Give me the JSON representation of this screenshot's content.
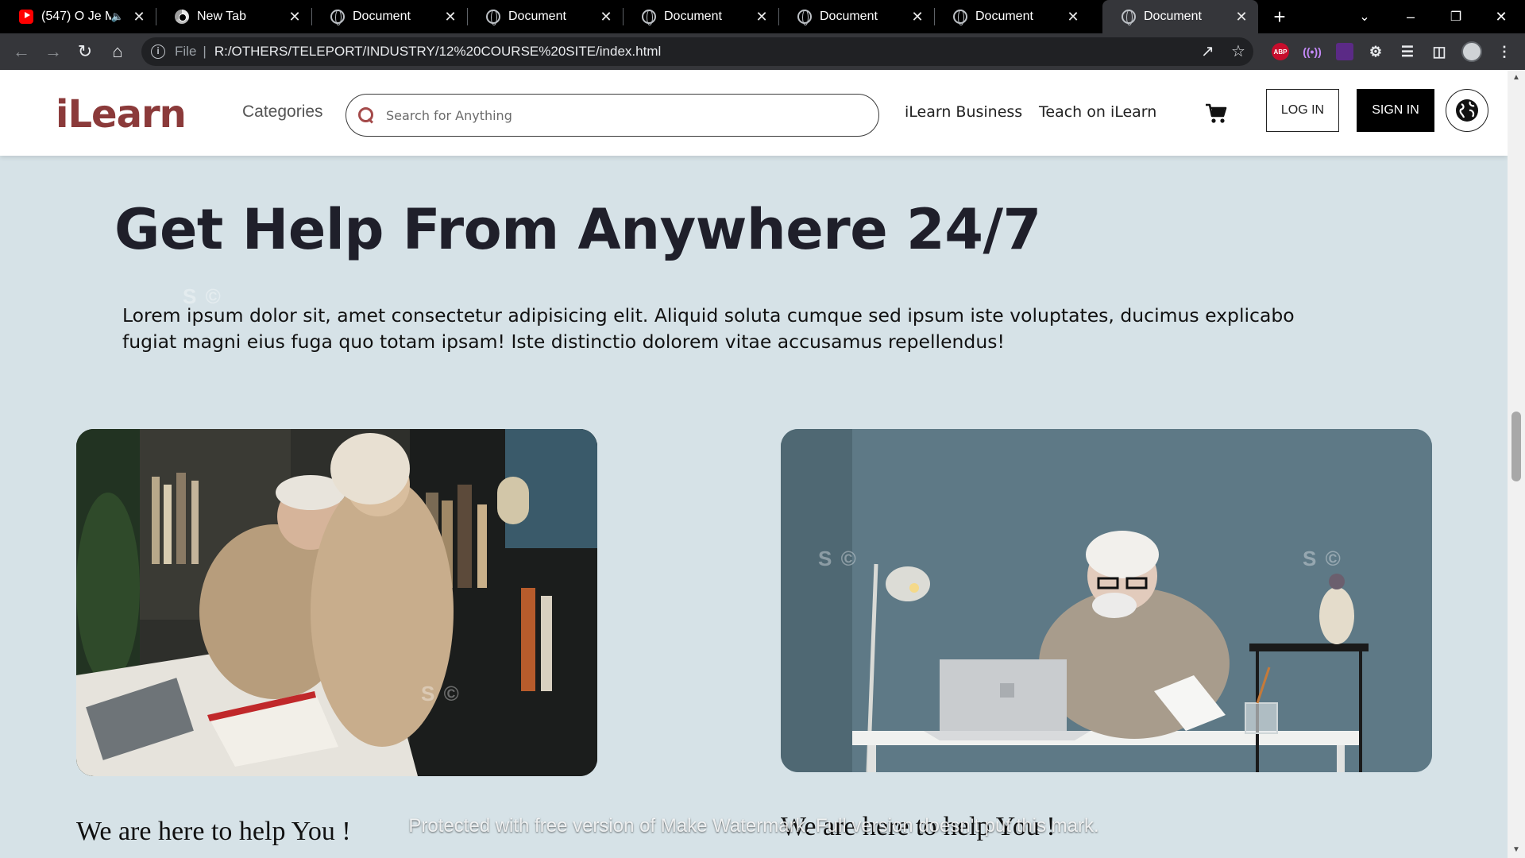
{
  "browser": {
    "tabs": [
      {
        "title": "(547) O Je Ma",
        "icon": "youtube-icon",
        "active": false
      },
      {
        "title": "New Tab",
        "icon": "chrome-icon",
        "active": false
      },
      {
        "title": "Document",
        "icon": "globe-icon",
        "active": false
      },
      {
        "title": "Document",
        "icon": "globe-icon",
        "active": false
      },
      {
        "title": "Document",
        "icon": "globe-icon",
        "active": false
      },
      {
        "title": "Document",
        "icon": "globe-icon",
        "active": false
      },
      {
        "title": "Document",
        "icon": "globe-icon",
        "active": false
      },
      {
        "title": "Document",
        "icon": "globe-icon",
        "active": true
      }
    ],
    "address": {
      "scheme": "File",
      "url": "R:/OTHERS/TELEPORT/INDUSTRY/12%20COURSE%20SITE/index.html"
    },
    "extensions": {
      "abp": "ABP"
    }
  },
  "site": {
    "logo": "iLearn",
    "nav": {
      "categories": "Categories",
      "business": "iLearn Business",
      "teach": "Teach on iLearn"
    },
    "search": {
      "placeholder": "Search for Anything"
    },
    "buttons": {
      "login": "LOG IN",
      "signin": "SIGN IN"
    }
  },
  "hero": {
    "title": "Get Help From Anywhere 24/7",
    "text": "Lorem ipsum dolor sit, amet consectetur adipisicing elit. Aliquid soluta cumque sed ipsum iste voluptates, ducimus explicabo fugiat magni eius fuga quo totam ipsam! Iste distinctio dolorem vitae accusamus repellendus!"
  },
  "cards": [
    {
      "caption": "We are here to help You !"
    },
    {
      "caption": "We are here to help You !"
    }
  ],
  "watermark": {
    "notice": "Protected with free version of Make Watermark. Full version doesn't put this mark.",
    "mark": "S ©"
  },
  "colors": {
    "page_bg": "#d6e2e7",
    "logo": "#8b3a3a",
    "chrome_bg": "#35363a"
  }
}
